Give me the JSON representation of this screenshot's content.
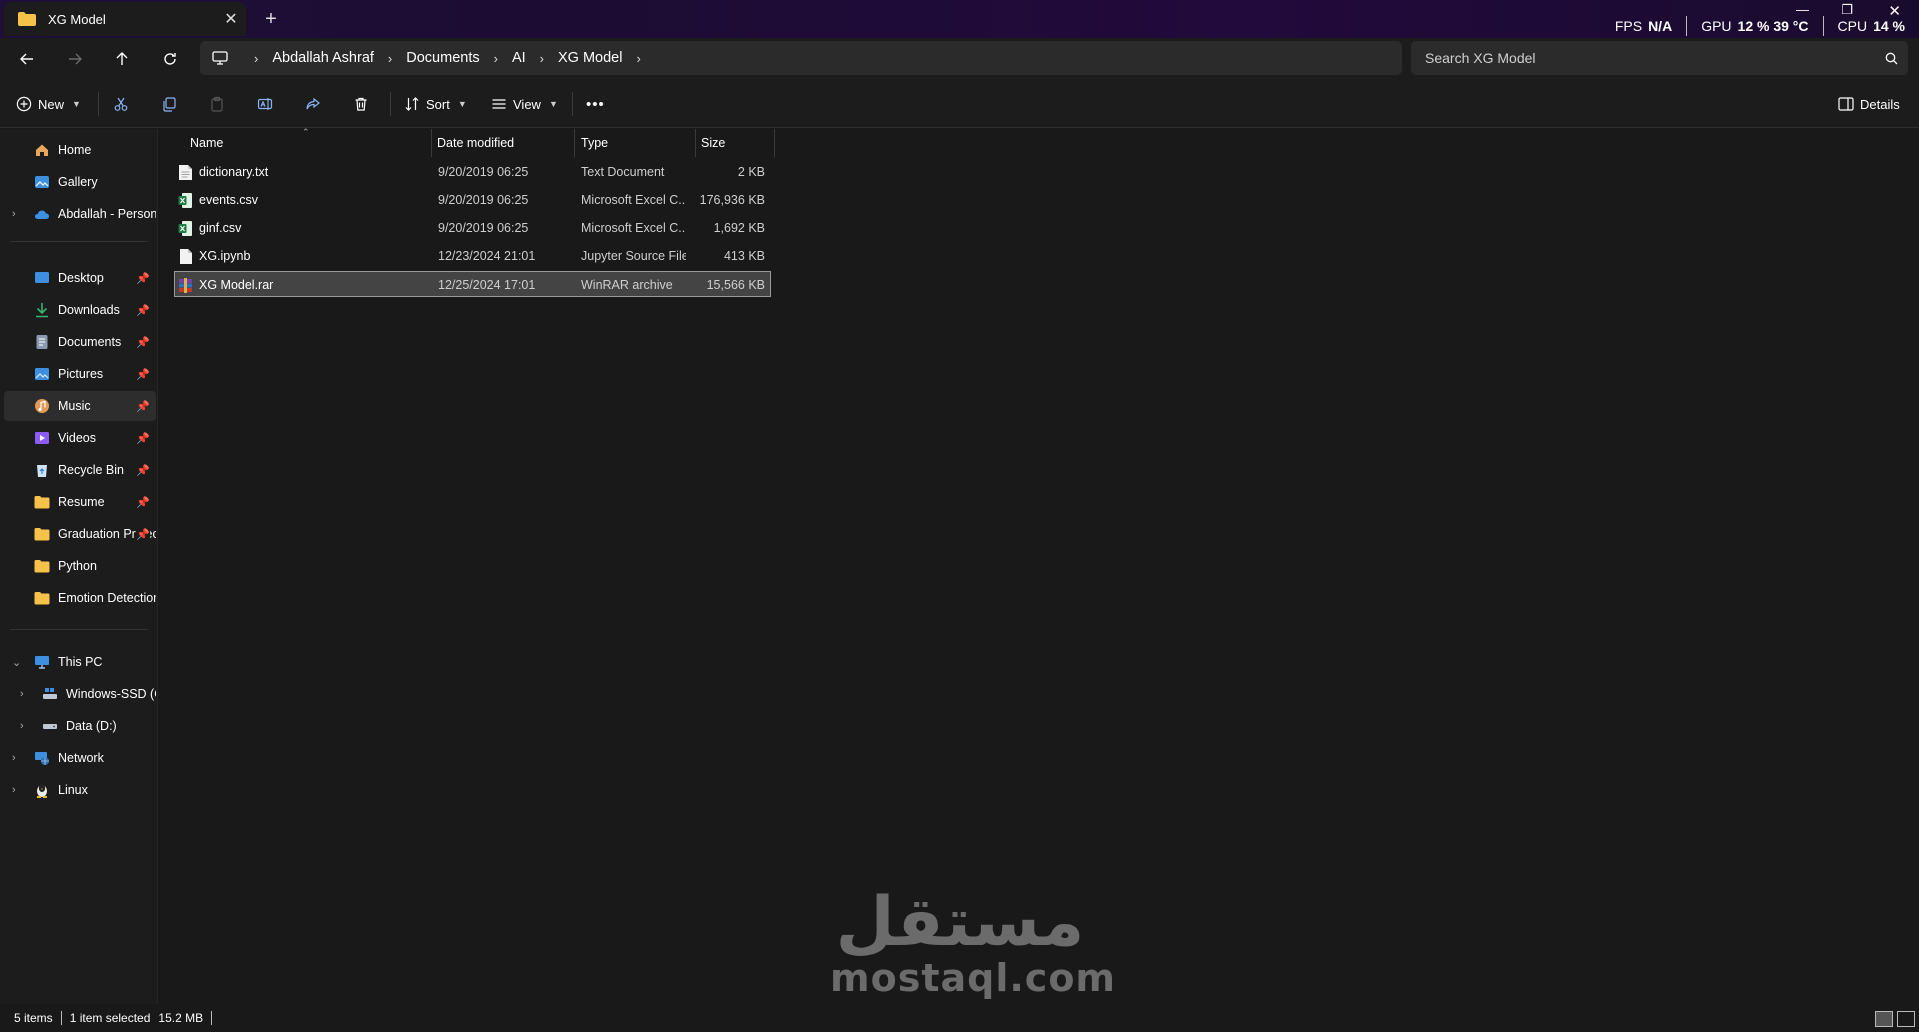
{
  "window": {
    "tab_title": "XG Model",
    "new_tab": "+",
    "close_tab": "✕"
  },
  "overlay": {
    "fps_label": "FPS",
    "fps_value": "N/A",
    "gpu_label": "GPU",
    "gpu_value": "12 % 39 °C",
    "cpu_label": "CPU",
    "cpu_value": "14 %"
  },
  "address": {
    "breadcrumbs": [
      "Abdallah Ashraf",
      "Documents",
      "AI",
      "XG Model"
    ],
    "search_placeholder": "Search XG Model"
  },
  "commands": {
    "new": "New",
    "sort": "Sort",
    "view": "View",
    "details": "Details",
    "more": "•••"
  },
  "sidebar": {
    "items": [
      {
        "label": "Home",
        "icon": "home-icon"
      },
      {
        "label": "Gallery",
        "icon": "gallery-icon"
      },
      {
        "label": "Abdallah - Personal",
        "icon": "onedrive-cloud-icon"
      },
      {
        "label": "Desktop",
        "icon": "desktop-icon"
      },
      {
        "label": "Downloads",
        "icon": "download-icon"
      },
      {
        "label": "Documents",
        "icon": "documents-icon"
      },
      {
        "label": "Pictures",
        "icon": "pictures-icon"
      },
      {
        "label": "Music",
        "icon": "music-icon"
      },
      {
        "label": "Videos",
        "icon": "videos-icon"
      },
      {
        "label": "Recycle Bin",
        "icon": "recycle-bin-icon"
      },
      {
        "label": "Resume",
        "icon": "folder-icon"
      },
      {
        "label": "Graduation Project",
        "icon": "folder-icon"
      },
      {
        "label": "Python",
        "icon": "folder-icon"
      },
      {
        "label": "Emotion Detection",
        "icon": "folder-icon"
      },
      {
        "label": "This PC",
        "icon": "this-pc-icon"
      },
      {
        "label": "Windows-SSD (C:)",
        "icon": "drive-icon"
      },
      {
        "label": "Data (D:)",
        "icon": "drive-icon"
      },
      {
        "label": "Network",
        "icon": "network-icon"
      },
      {
        "label": "Linux",
        "icon": "linux-penguin-icon"
      }
    ]
  },
  "columns": {
    "name": "Name",
    "date": "Date modified",
    "type": "Type",
    "size": "Size"
  },
  "files": [
    {
      "name": "dictionary.txt",
      "date": "9/20/2019 06:25",
      "type": "Text Document",
      "size": "2 KB",
      "icon": "text-file-icon"
    },
    {
      "name": "events.csv",
      "date": "9/20/2019 06:25",
      "type": "Microsoft Excel C...",
      "size": "176,936 KB",
      "icon": "excel-file-icon"
    },
    {
      "name": "ginf.csv",
      "date": "9/20/2019 06:25",
      "type": "Microsoft Excel C...",
      "size": "1,692 KB",
      "icon": "excel-file-icon"
    },
    {
      "name": "XG.ipynb",
      "date": "12/23/2024 21:01",
      "type": "Jupyter Source File",
      "size": "413 KB",
      "icon": "generic-file-icon"
    },
    {
      "name": "XG Model.rar",
      "date": "12/25/2024 17:01",
      "type": "WinRAR archive",
      "size": "15,566 KB",
      "icon": "winrar-archive-icon",
      "selected": true
    }
  ],
  "status": {
    "item_count": "5 items",
    "selected": "1 item selected",
    "selected_size": "15.2 MB"
  },
  "watermark": {
    "arabic": "مستقل",
    "latin": "mostaql.com"
  },
  "colors": {
    "accent_folder": "#f7c24a",
    "excel_green": "#1f7a43",
    "selection": "#444444"
  }
}
